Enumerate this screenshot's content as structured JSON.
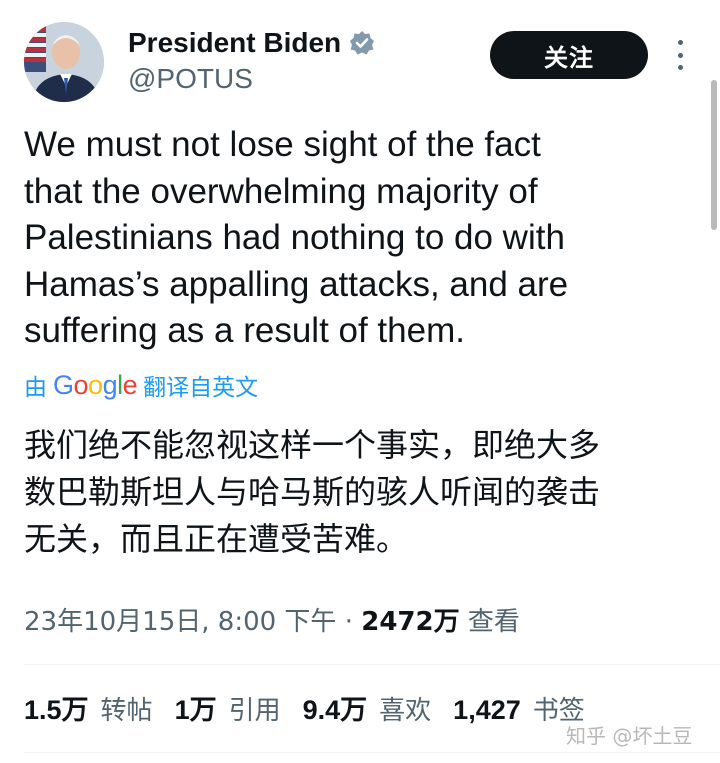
{
  "user": {
    "display_name": "President Biden",
    "handle": "@POTUS",
    "verified_icon": "verified-badge-icon",
    "badge_color": "#829aab"
  },
  "follow_button": {
    "label": "关注"
  },
  "more_icon": "more-options-icon",
  "tweet": {
    "lines": [
      "We must not lose sight of the fact",
      "that the overwhelming majority of",
      "Palestinians had nothing to do with",
      "Hamas’s appalling attacks, and are",
      "suffering as a result of them."
    ]
  },
  "translation": {
    "prefix": "由",
    "provider": "Google",
    "suffix": "翻译自英文",
    "lines": [
      "我们绝不能忽视这样一个事实，即绝大多",
      "数巴勒斯坦人与哈马斯的骇人听闻的袭击",
      "无关，而且正在遭受苦难。"
    ]
  },
  "meta": {
    "timestamp": "23年10月15日, 8:00 下午 · ",
    "views_count": "2472万",
    "views_label": " 查看"
  },
  "stats": [
    {
      "count": "1.5万",
      "label": "转帖"
    },
    {
      "count": "1万",
      "label": "引用"
    },
    {
      "count": "9.4万",
      "label": "喜欢"
    },
    {
      "count": "1,427",
      "label": "书签"
    }
  ],
  "watermark": "知乎 @坏土豆",
  "colors": {
    "text_primary": "#0f1419",
    "text_secondary": "#536471",
    "link_blue": "#1d9bf0",
    "button_bg": "#0f1419"
  }
}
